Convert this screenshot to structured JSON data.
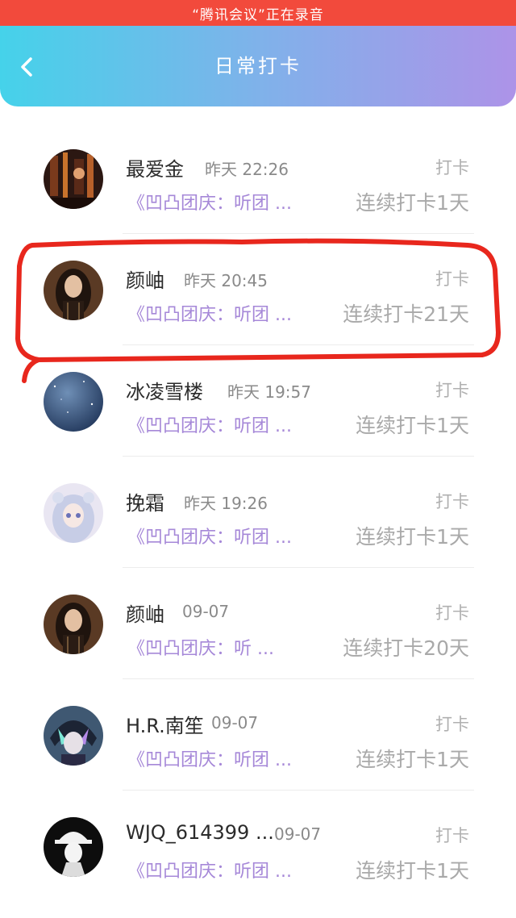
{
  "status_bar": {
    "recording_text": "“腾讯会议”正在录音"
  },
  "header": {
    "title": "日常打卡",
    "back_icon": "chevron-left-icon"
  },
  "colors": {
    "recording_bar": "#f24a3c",
    "header_gradient": [
      "#45d2ea",
      "#ad93e8"
    ],
    "link": "#a688d8",
    "highlight_annotation": "#e8271d"
  },
  "entries": [
    {
      "name": "最爱金",
      "time": "昨天 22:26",
      "action": "打卡",
      "group": "《凹凸团庆：听团 ...",
      "streak": "连续打卡1天"
    },
    {
      "name": "颜岫",
      "time": "昨天 20:45",
      "action": "打卡",
      "group": "《凹凸团庆：听团 ...",
      "streak": "连续打卡21天"
    },
    {
      "name": "冰凌雪楼",
      "time": "昨天 19:57",
      "action": "打卡",
      "group": "《凹凸团庆：听团 ...",
      "streak": "连续打卡1天"
    },
    {
      "name": "挽霜",
      "time": "昨天 19:26",
      "action": "打卡",
      "group": "《凹凸团庆：听团 ...",
      "streak": "连续打卡1天"
    },
    {
      "name": "颜岫",
      "time": "09-07",
      "action": "打卡",
      "group": "《凹凸团庆：听 ...",
      "streak": "连续打卡20天"
    },
    {
      "name": "H.R.南笙",
      "time": "09-07",
      "action": "打卡",
      "group": "《凹凸团庆：听团 ...",
      "streak": "连续打卡1天"
    },
    {
      "name": "WJQ_614399 ...",
      "time": "09-07",
      "action": "打卡",
      "group": "《凹凸团庆：听团 ...",
      "streak": "连续打卡1天"
    }
  ]
}
